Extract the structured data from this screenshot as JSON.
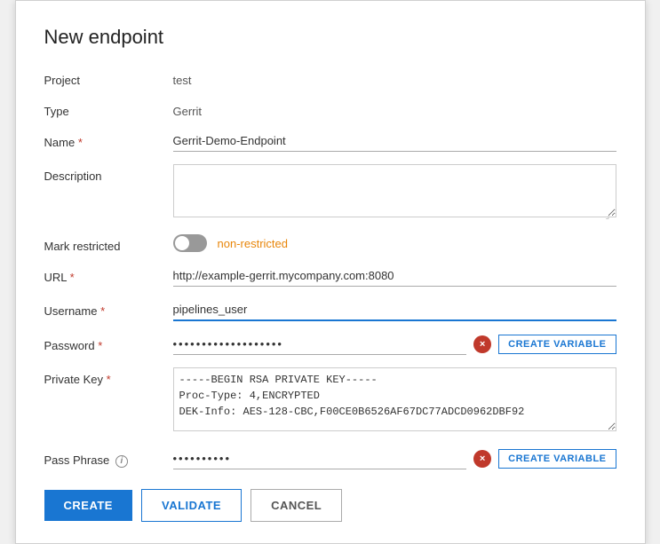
{
  "dialog": {
    "title": "New endpoint"
  },
  "form": {
    "project_label": "Project",
    "project_value": "test",
    "type_label": "Type",
    "type_value": "Gerrit",
    "name_label": "Name",
    "name_required": "*",
    "name_value": "Gerrit-Demo-Endpoint",
    "description_label": "Description",
    "description_value": "",
    "description_placeholder": "",
    "mark_restricted_label": "Mark restricted",
    "toggle_state": "non-restricted",
    "url_label": "URL",
    "url_required": "*",
    "url_value": "http://example-gerrit.mycompany.com:8080",
    "username_label": "Username",
    "username_required": "*",
    "username_value": "pipelines_user",
    "password_label": "Password",
    "password_required": "*",
    "password_value": "••••••••••••••••••••••••••••",
    "password_clear_label": "×",
    "create_variable_label": "CREATE VARIABLE",
    "private_key_label": "Private Key",
    "private_key_required": "*",
    "private_key_value": "-----BEGIN RSA PRIVATE KEY-----\nProc-Type: 4,ENCRYPTED\nDEK-Info: AES-128-CBC,F00CE0B6526AF67DC77ADCD0962DBF92",
    "pass_phrase_label": "Pass Phrase",
    "pass_phrase_info": "i",
    "pass_phrase_value": "•••••••",
    "pass_phrase_clear_label": "×",
    "create_variable2_label": "CREATE VARIABLE"
  },
  "buttons": {
    "create_label": "CREATE",
    "validate_label": "VALIDATE",
    "cancel_label": "CANCEL"
  }
}
